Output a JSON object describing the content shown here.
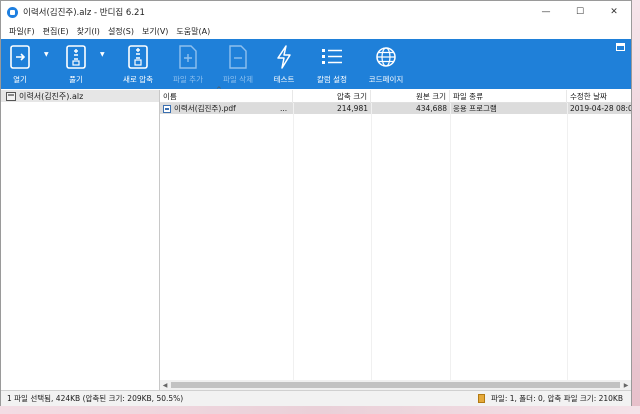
{
  "window": {
    "title": "이력서(김진주).alz - 반디집 6.21",
    "controls": {
      "minimize": "—",
      "maximize": "☐",
      "close": "✕"
    }
  },
  "menu": [
    "파일(F)",
    "편집(E)",
    "찾기(I)",
    "설정(S)",
    "보기(V)",
    "도움말(A)"
  ],
  "toolbar": {
    "open": "열기",
    "extract": "풀기",
    "new_archive": "새로 압축",
    "add_file": "파일 추가",
    "delete_file": "파일 삭제",
    "test": "테스트",
    "column_settings": "칼럼 설정",
    "codepage": "코드페이지"
  },
  "tree": {
    "root": "이력서(김진주).alz"
  },
  "columns": {
    "name": "이름",
    "compressed_size": "압축 크기",
    "original_size": "원본 크기",
    "file_type": "파일 종류",
    "modified": "수정한 날짜"
  },
  "files": [
    {
      "name": "이력서(김진주).pdf",
      "ellipsis": "...",
      "compressed_size": "214,981",
      "original_size": "434,688",
      "file_type": "응용 프로그램",
      "modified": "2019-04-28 08:08"
    }
  ],
  "status": {
    "left": "1 파일 선택됨, 424KB (압축된 크기: 209KB, 50.5%)",
    "right": "파일: 1, 폴더: 0, 압축 파일 크기: 210KB"
  },
  "colors": {
    "toolbar": "#1f80d9",
    "selection": "#dcdcdc"
  }
}
